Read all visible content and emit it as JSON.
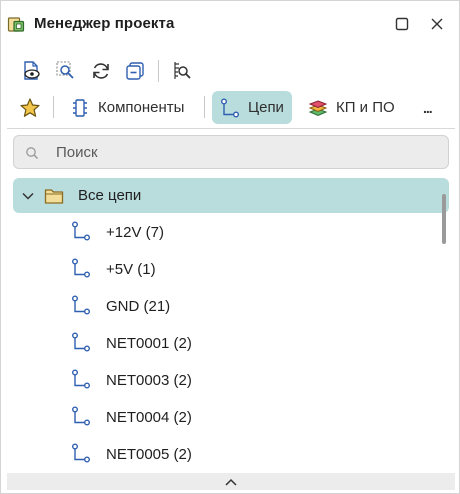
{
  "window": {
    "title": "Менеджер проекта",
    "app_icon": "project-manager-icon",
    "controls": [
      "maximize-icon",
      "close-icon"
    ]
  },
  "toolbar": {
    "buttons": [
      "document-view-icon",
      "zoom-select-icon",
      "refresh-icon",
      "collapse-icon",
      "find-in-list-icon"
    ]
  },
  "tabs": [
    {
      "label": "",
      "icon": "star-icon",
      "active": false
    },
    {
      "label": "Компоненты",
      "icon": "component-icon",
      "active": false
    },
    {
      "label": "Цепи",
      "icon": "net-icon",
      "active": true
    },
    {
      "label": "КП и ПО",
      "icon": "pads-vias-icon",
      "active": false
    }
  ],
  "more_label": "...",
  "search": {
    "placeholder": "Поиск",
    "value": ""
  },
  "tree": {
    "root_label": "Все цепи",
    "nets": [
      "+12V (7)",
      "+5V (1)",
      "GND (21)",
      "NET0001 (2)",
      "NET0003 (2)",
      "NET0004 (2)",
      "NET0005 (2)"
    ]
  },
  "colors": {
    "accent": "#b9dcdc",
    "icon_blue": "#2f5fb0",
    "folder": "#d9b86a"
  }
}
